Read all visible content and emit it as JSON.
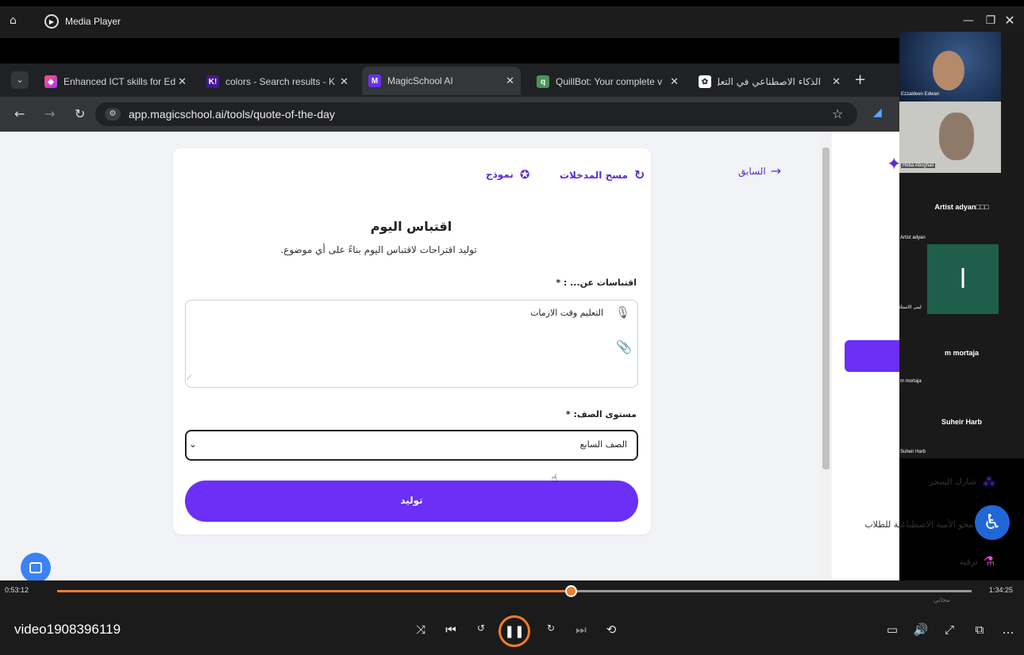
{
  "player": {
    "title": "Media Player",
    "video_name": "video1908396119",
    "time_current": "0:53:12",
    "time_total": "1:34:25",
    "progress": 0.562
  },
  "browser": {
    "tabs": [
      {
        "label": "Enhanced ICT skills for Ed",
        "icon": "gradient-logo-icon"
      },
      {
        "label": "colors - Search results - K",
        "icon": "kahoot-icon"
      },
      {
        "label": "MagicSchool AI",
        "icon": "magicschool-icon",
        "active": true
      },
      {
        "label": "QuillBot: Your complete v",
        "icon": "quillbot-icon"
      },
      {
        "label": "الذكاء الاصطناعي في التعل",
        "icon": "site-icon"
      }
    ],
    "url": "app.magicschool.ai/tools/quote-of-the-day"
  },
  "page": {
    "back_label": "السابق",
    "clear_label": "مسح المدخلات",
    "example_label": "نموذج",
    "tool_title": "اقتباس اليوم",
    "tool_subtitle": "توليد اقتراحات لاقتباس اليوم بناءً على أي موضوع.",
    "quotes_label": "اقتباسات عن... : *",
    "quotes_value": "التعليم وقت الازمات",
    "grade_label": "مستوى الصف: *",
    "grade_value": "الصف السابع",
    "generate_label": "توليد"
  },
  "sidebar": {
    "items": [
      {
        "label": "شارك السحر"
      },
      {
        "label": "محو الأمية الاصطناعية للطلاب"
      },
      {
        "label": "ترقية"
      }
    ],
    "bottom_text": "مجاني"
  },
  "participants": [
    {
      "name": "Ezzaldeen Edwan"
    },
    {
      "name": "Heba Abughali"
    },
    {
      "name": "Artist adyan□□□",
      "sub": "Artist adyan"
    },
    {
      "name": "لبنى الاستاذ",
      "initial": "l"
    },
    {
      "name": "m mortaja",
      "sub": "m mortaja"
    },
    {
      "name": "Suheir Harb",
      "sub": "Suheir Harb"
    }
  ],
  "colors": {
    "brand_purple": "#6b2ff5",
    "seek_orange": "#f07c2f"
  }
}
